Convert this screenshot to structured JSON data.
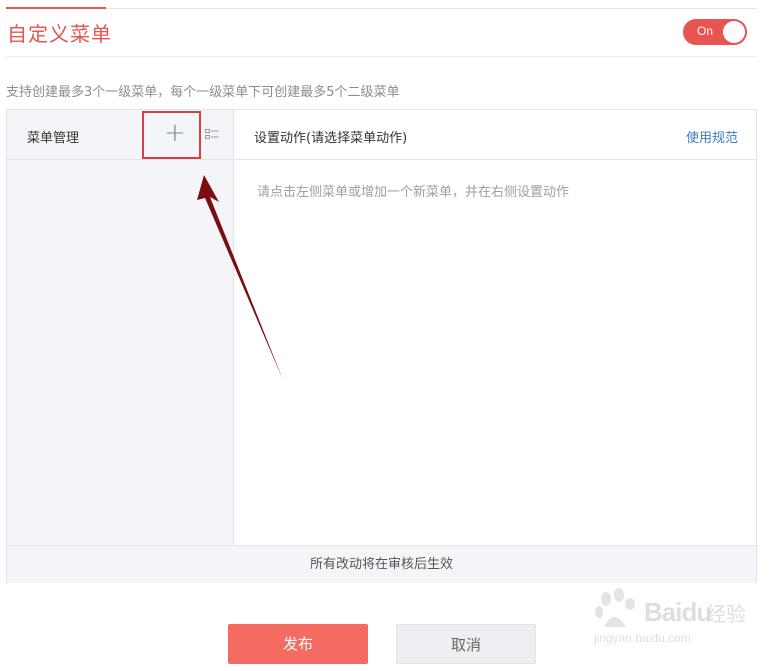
{
  "header": {
    "title": "自定义菜单",
    "toggle_label": "On"
  },
  "hint": "支持创建最多3个一级菜单，每个一级菜单下可创建最多5个二级菜单",
  "sidebar": {
    "title": "菜单管理",
    "add_symbol": "+"
  },
  "main": {
    "title": "设置动作(请选择菜单动作)",
    "usage_link": "使用规范",
    "placeholder": "请点击左侧菜单或增加一个新菜单，并在右侧设置动作"
  },
  "footer_note": "所有改动将在审核后生效",
  "actions": {
    "publish": "发布",
    "cancel": "取消"
  },
  "watermark": {
    "brand": "Baidu",
    "brand_cn": "经验",
    "url": "jingyan.baidu.com"
  },
  "colors": {
    "accent": "#e8544f",
    "publish_button": "#f36b61",
    "highlight_box": "#d9403d",
    "arrow": "#7a0e12",
    "link": "#3a7bc8"
  },
  "icons": {
    "add": "plus-icon",
    "sort": "sort-icon",
    "arrow": "arrow-annotation"
  }
}
